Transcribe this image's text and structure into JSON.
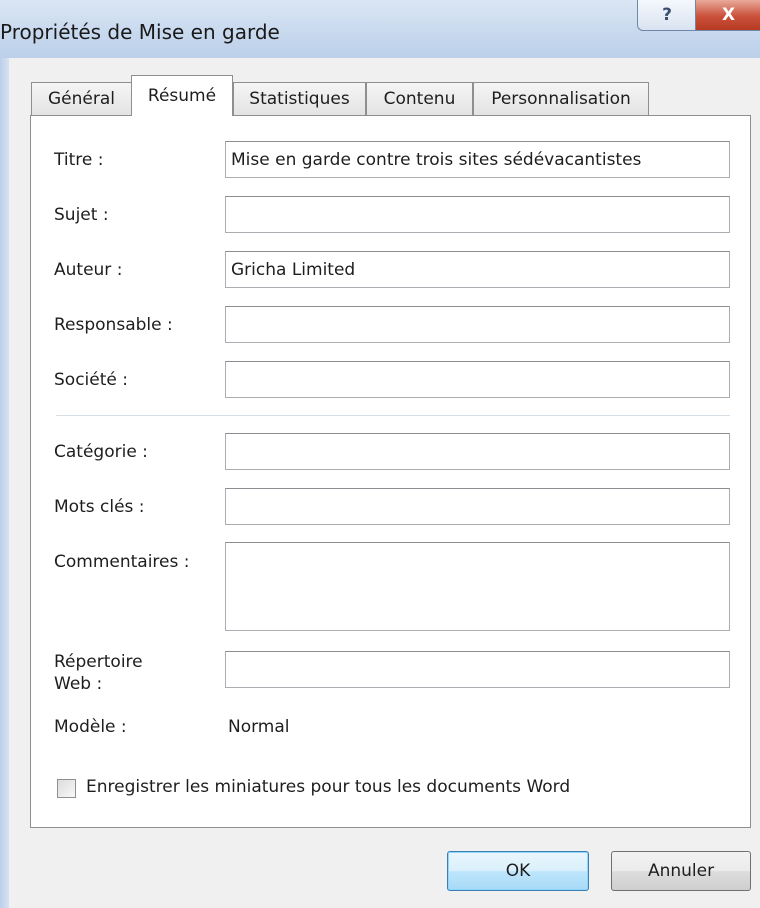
{
  "window": {
    "title": "Propriétés de Mise en garde",
    "help_glyph": "?",
    "close_glyph": "X"
  },
  "tabs": [
    {
      "label": "Général",
      "active": false
    },
    {
      "label": "Résumé",
      "active": true
    },
    {
      "label": "Statistiques",
      "active": false
    },
    {
      "label": "Contenu",
      "active": false
    },
    {
      "label": "Personnalisation",
      "active": false
    }
  ],
  "summary": {
    "title_label": "Titre :",
    "title_value": "Mise en garde contre trois sites sédévacantistes",
    "subject_label": "Sujet :",
    "subject_value": "",
    "author_label": "Auteur :",
    "author_value": "Gricha Limited",
    "manager_label": "Responsable :",
    "manager_value": "",
    "company_label": "Société :",
    "company_value": "",
    "category_label": "Catégorie :",
    "category_value": "",
    "keywords_label": "Mots clés :",
    "keywords_value": "",
    "comments_label": "Commentaires :",
    "comments_value": "",
    "hyperlink_label_line1": "Répertoire",
    "hyperlink_label_line2": "Web :",
    "hyperlink_value": "",
    "template_label": "Modèle :",
    "template_value": "Normal",
    "thumbnails_label": "Enregistrer les miniatures pour tous les documents Word",
    "thumbnails_checked": false
  },
  "buttons": {
    "ok": "OK",
    "cancel": "Annuler"
  },
  "colors": {
    "titlebar": "#c7d8ee",
    "close": "#c9503a",
    "panel": "#ffffff",
    "default_button": "#bee6fd"
  }
}
